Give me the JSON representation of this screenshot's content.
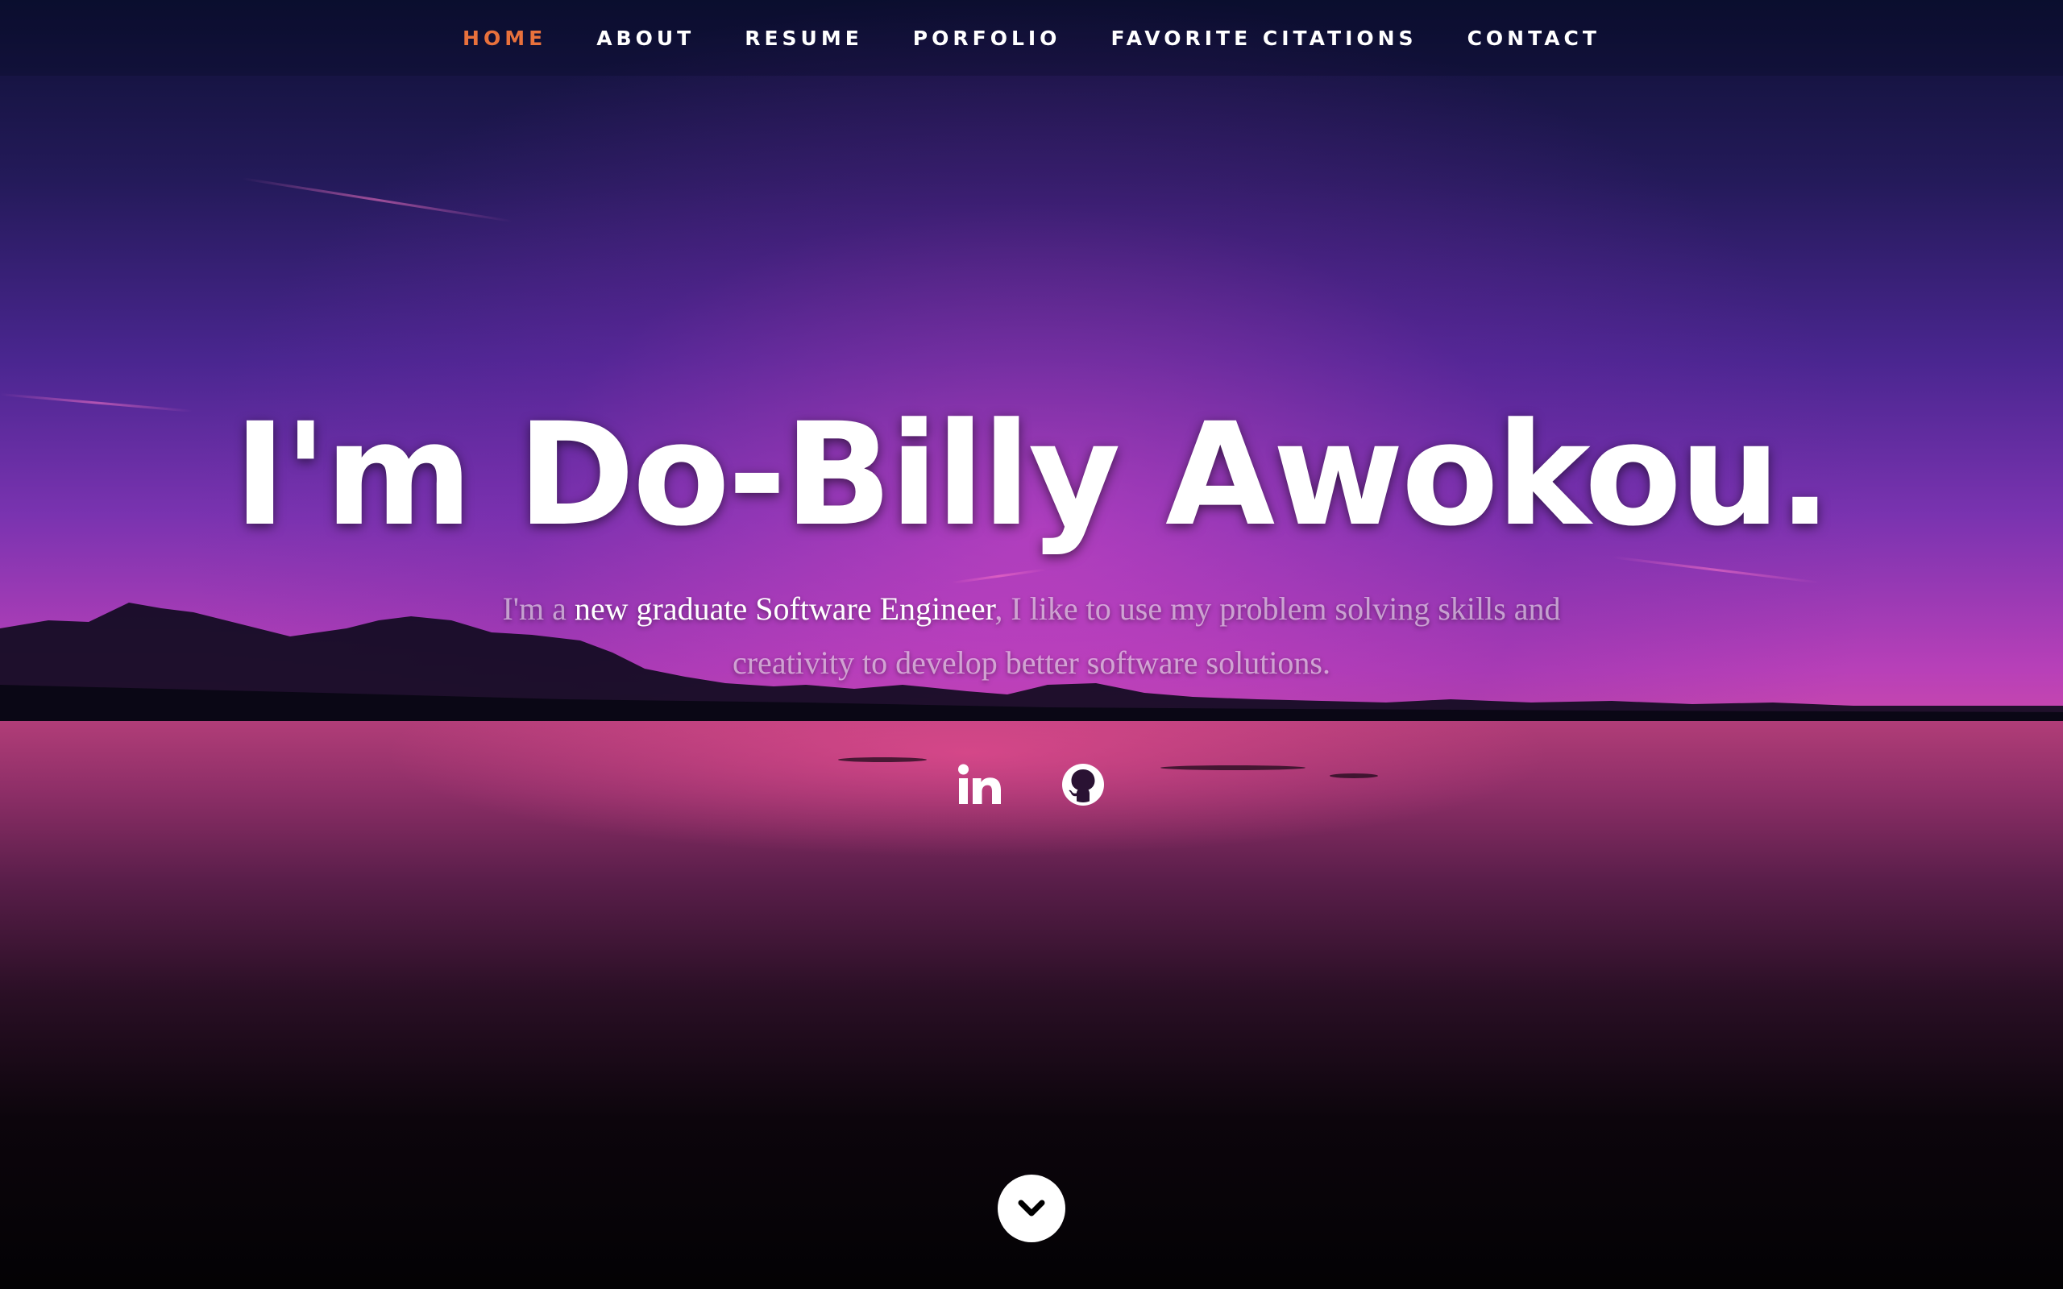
{
  "nav": {
    "items": [
      {
        "label": "HOME",
        "active": true
      },
      {
        "label": "ABOUT",
        "active": false
      },
      {
        "label": "RESUME",
        "active": false
      },
      {
        "label": "PORFOLIO",
        "active": false
      },
      {
        "label": "FAVORITE CITATIONS",
        "active": false
      },
      {
        "label": "CONTACT",
        "active": false
      }
    ],
    "active_color": "#e8713c"
  },
  "hero": {
    "title": "I'm Do-Billy Awokou.",
    "tagline_prefix": "I'm a ",
    "tagline_highlight": "new graduate Software Engineer",
    "tagline_suffix": ", I like to use my problem solving skills and creativity to develop better software solutions."
  },
  "social": [
    {
      "icon": "linkedin-icon"
    },
    {
      "icon": "github-icon"
    }
  ],
  "scroll_down": {
    "icon": "chevron-down-icon"
  }
}
